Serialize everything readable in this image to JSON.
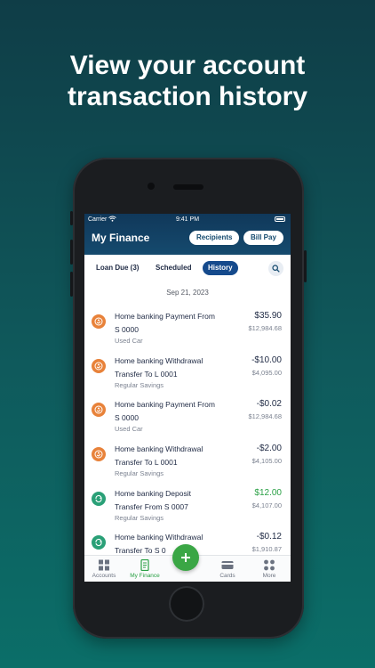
{
  "headline": {
    "line1": "View your account",
    "line2": "transaction history"
  },
  "status_bar": {
    "carrier": "Carrier",
    "time": "9:41 PM"
  },
  "header": {
    "title": "My Finance",
    "recipients_label": "Recipients",
    "billpay_label": "Bill Pay"
  },
  "tabs": {
    "loan_due": "Loan Due (3)",
    "scheduled": "Scheduled",
    "history": "History"
  },
  "date_header": "Sep 21, 2023",
  "transactions": [
    {
      "line1": "Home banking Payment From",
      "line2": "S 0000",
      "sub": "Used Car",
      "amount": "$35.90",
      "balance": "$12,984.68",
      "type": "payment"
    },
    {
      "line1": "Home banking Withdrawal",
      "line2": "Transfer To L 0001",
      "sub": "Regular Savings",
      "amount": "-$10.00",
      "balance": "$4,095.00",
      "type": "payment"
    },
    {
      "line1": "Home banking Payment From",
      "line2": "S 0000",
      "sub": "Used Car",
      "amount": "-$0.02",
      "balance": "$12,984.68",
      "type": "payment"
    },
    {
      "line1": "Home banking Withdrawal",
      "line2": "Transfer To L 0001",
      "sub": "Regular Savings",
      "amount": "-$2.00",
      "balance": "$4,105.00",
      "type": "payment"
    },
    {
      "line1": "Home banking Deposit",
      "line2": "Transfer From S 0007",
      "sub": "Regular Savings",
      "amount": "$12.00",
      "balance": "$4,107.00",
      "type": "transfer"
    },
    {
      "line1": "Home banking Withdrawal",
      "line2": "Transfer To S 0",
      "sub": "",
      "amount": "-$0.12",
      "balance": "$1,910.87",
      "type": "transfer"
    }
  ],
  "bottom_nav": {
    "accounts": "Accounts",
    "my_finance": "My Finance",
    "cards": "Cards",
    "more": "More"
  },
  "icons": {
    "payment": "hand-coin-icon",
    "transfer": "cycle-arrows-icon",
    "fab": "plus-icon"
  },
  "colors": {
    "payment_icon": "#e8823a",
    "transfer_icon": "#2aa077",
    "positive_amount": "#2aa045",
    "accent_blue": "#154a8c",
    "fab_green": "#3aa645"
  }
}
